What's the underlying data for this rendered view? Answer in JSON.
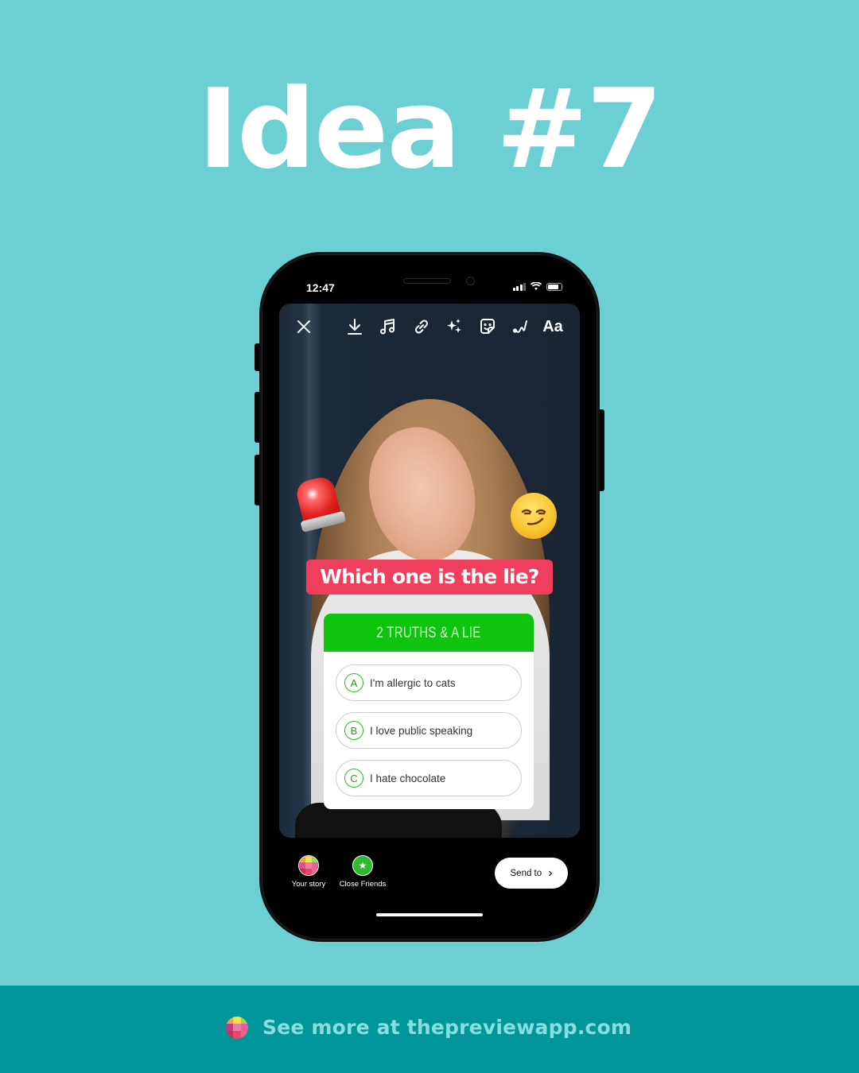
{
  "headline": "Idea #7",
  "phone": {
    "status_bar": {
      "time": "12:47",
      "icons": [
        "signal-icon",
        "wifi-icon",
        "battery-icon"
      ]
    },
    "toolbar": {
      "items": [
        {
          "name": "close",
          "icon": "close-icon"
        },
        {
          "name": "download",
          "icon": "download-icon"
        },
        {
          "name": "music",
          "icon": "music-icon"
        },
        {
          "name": "link",
          "icon": "link-icon"
        },
        {
          "name": "effects",
          "icon": "sparkles-icon"
        },
        {
          "name": "sticker",
          "icon": "sticker-icon"
        },
        {
          "name": "draw",
          "icon": "draw-icon"
        },
        {
          "name": "text",
          "label": "Aa"
        }
      ]
    },
    "stickers": {
      "left": "police-siren-emoji",
      "right": "smirking-face-emoji"
    },
    "question_label": "Which one is the lie?",
    "quiz": {
      "title": "2 TRUTHS & A LIE",
      "options": [
        {
          "letter": "A",
          "text": "I'm allergic to cats"
        },
        {
          "letter": "B",
          "text": "I love public speaking"
        },
        {
          "letter": "C",
          "text": "I hate chocolate"
        }
      ],
      "accent_color": "#0ec40e"
    },
    "share": {
      "your_story_label": "Your story",
      "close_friends_label": "Close Friends",
      "send_to_label": "Send to"
    }
  },
  "footer": {
    "text": "See more at thepreviewapp.com"
  },
  "colors": {
    "background": "#6bcfd4",
    "footer": "#02969b",
    "question_label": "#ef3f5c"
  }
}
